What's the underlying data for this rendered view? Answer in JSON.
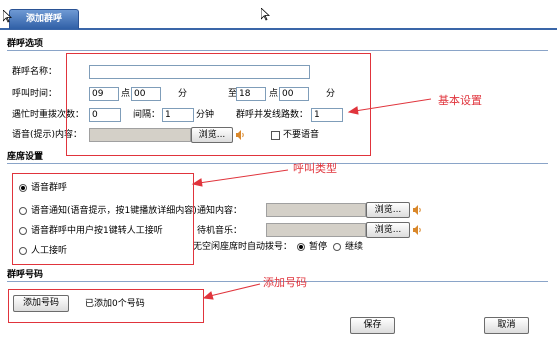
{
  "tab": {
    "label": "添加群呼"
  },
  "basic": {
    "title": "群呼选项",
    "name_label": "群呼名称：",
    "name_value": "",
    "time_label": "呼叫时间：",
    "start_hour": "09",
    "hour_unit": "点",
    "start_min": "00",
    "min_unit": "分",
    "to_label": "至",
    "end_hour": "18",
    "end_hour_unit": "点",
    "end_min": "00",
    "end_min_unit": "分",
    "retry_label": "遇忙时重拨次数：",
    "retry_value": "0",
    "interval_label": "间隔：",
    "interval_value": "1",
    "interval_unit": "分钟",
    "lines_label": "群呼并发线路数：",
    "lines_value": "1",
    "voice_label": "语音(提示)内容：",
    "voice_value": "",
    "browse_label": "浏览...",
    "no_voice_label": "不要语音"
  },
  "seat": {
    "title": "座席设置",
    "options": [
      "语音群呼",
      "语音通知(语音提示，按1键播放详细内容)",
      "语音群呼中用户按1键转人工接听",
      "人工接听"
    ],
    "selected_index": 0,
    "notify_label": "通知内容：",
    "notify_value": "",
    "hold_label": "待机音乐：",
    "hold_value": "",
    "browse_label": "浏览...",
    "auto_dial_label": "无空闲座席时自动拨号：",
    "pause_label": "暂停",
    "continue_label": "继续",
    "auto_dial_selected": "pause"
  },
  "numbers": {
    "title": "群呼号码",
    "add_button": "添加号码",
    "count_text": "已添加0个号码"
  },
  "footer": {
    "save_label": "保存",
    "cancel_label": "取消"
  },
  "annotations": {
    "basic": "基本设置",
    "call_type": "呼叫类型",
    "add_number": "添加号码",
    "color": "#e0343c"
  }
}
